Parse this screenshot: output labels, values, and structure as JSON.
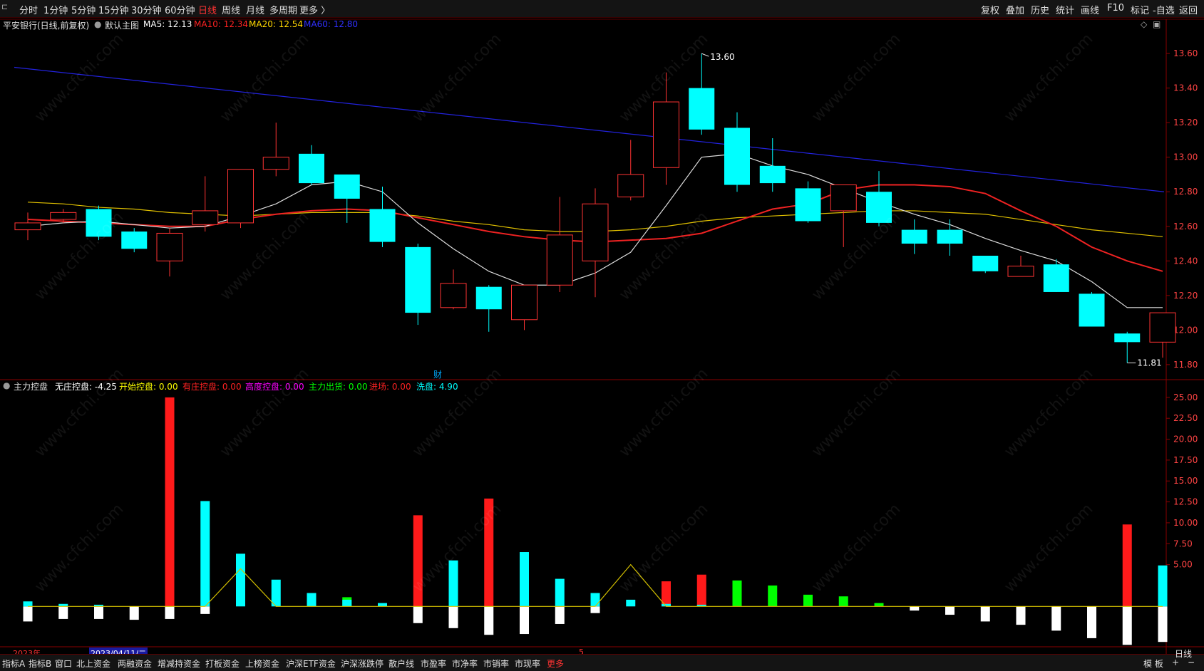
{
  "toolbar": {
    "back_icon": "back-arrow-icon",
    "periods": [
      "分时",
      "1分钟",
      "5分钟",
      "15分钟",
      "30分钟",
      "60分钟",
      "日线",
      "周线",
      "月线",
      "多周期",
      "更多 〉"
    ],
    "active_period": "日线",
    "right_buttons": [
      "复权",
      "叠加",
      "历史",
      "统计",
      "画线",
      "F10",
      "标记",
      "-自选",
      "返回"
    ]
  },
  "main_info": {
    "stock_title": "平安银行(日线,前复权)",
    "chart_name": "默认主图",
    "ma5": "MA5: 12.13",
    "ma10": "MA10: 12.34",
    "ma20": "MA20: 12.54",
    "ma60": "MA60: 12.80",
    "colors": {
      "ma5": "#ffffff",
      "ma10": "#ff2222",
      "ma20": "#ffd700",
      "ma60": "#3030ff",
      "up": "#ff3333",
      "down": "#00ffff"
    }
  },
  "indicator_info": {
    "name": "主力控盘",
    "items": [
      {
        "label": "无庄控盘: -4.25",
        "color": "#ffffff"
      },
      {
        "label": "开始控盘: 0.00",
        "color": "#ffff00"
      },
      {
        "label": "有庄控盘: 0.00",
        "color": "#ff2222"
      },
      {
        "label": "高度控盘: 0.00",
        "color": "#ff00ff"
      },
      {
        "label": "主力出货: 0.00",
        "color": "#00ff00"
      },
      {
        "label": "进场: 0.00",
        "color": "#ff2222"
      },
      {
        "label": "洗盘: 4.90",
        "color": "#00ffff"
      }
    ]
  },
  "chart_data": [
    {
      "type": "candlestick",
      "y_ticks": [
        "13.60",
        "13.40",
        "13.20",
        "13.00",
        "12.80",
        "12.60",
        "12.40",
        "12.20",
        "12.00",
        "11.80"
      ],
      "ylim": [
        11.75,
        13.72
      ],
      "high_label": "13.60",
      "low_label": "11.81",
      "event_marker": "财",
      "candles": [
        {
          "o": 12.58,
          "c": 12.62,
          "h": 12.68,
          "l": 12.52
        },
        {
          "o": 12.64,
          "c": 12.68,
          "h": 12.7,
          "l": 12.62
        },
        {
          "o": 12.7,
          "c": 12.54,
          "h": 12.72,
          "l": 12.52
        },
        {
          "o": 12.57,
          "c": 12.47,
          "h": 12.59,
          "l": 12.45
        },
        {
          "o": 12.4,
          "c": 12.56,
          "h": 12.59,
          "l": 12.31
        },
        {
          "o": 12.61,
          "c": 12.69,
          "h": 12.89,
          "l": 12.57
        },
        {
          "o": 12.62,
          "c": 12.93,
          "h": 12.93,
          "l": 12.59
        },
        {
          "o": 12.93,
          "c": 13.0,
          "h": 13.2,
          "l": 12.89
        },
        {
          "o": 13.02,
          "c": 12.85,
          "h": 13.07,
          "l": 12.84
        },
        {
          "o": 12.9,
          "c": 12.76,
          "h": 12.9,
          "l": 12.62
        },
        {
          "o": 12.7,
          "c": 12.51,
          "h": 12.83,
          "l": 12.48
        },
        {
          "o": 12.48,
          "c": 12.1,
          "h": 12.5,
          "l": 12.03
        },
        {
          "o": 12.13,
          "c": 12.27,
          "h": 12.35,
          "l": 12.12
        },
        {
          "o": 12.25,
          "c": 12.12,
          "h": 12.26,
          "l": 11.99
        },
        {
          "o": 12.06,
          "c": 12.26,
          "h": 12.26,
          "l": 12.0
        },
        {
          "o": 12.26,
          "c": 12.55,
          "h": 12.77,
          "l": 12.22
        },
        {
          "o": 12.4,
          "c": 12.73,
          "h": 12.82,
          "l": 12.19
        },
        {
          "o": 12.77,
          "c": 12.9,
          "h": 13.1,
          "l": 12.75
        },
        {
          "o": 12.94,
          "c": 13.32,
          "h": 13.49,
          "l": 12.84
        },
        {
          "o": 13.4,
          "c": 13.16,
          "h": 13.6,
          "l": 13.13
        },
        {
          "o": 13.17,
          "c": 12.84,
          "h": 13.26,
          "l": 12.8
        },
        {
          "o": 12.95,
          "c": 12.85,
          "h": 13.11,
          "l": 12.8
        },
        {
          "o": 12.82,
          "c": 12.63,
          "h": 12.86,
          "l": 12.62
        },
        {
          "o": 12.69,
          "c": 12.84,
          "h": 12.84,
          "l": 12.48
        },
        {
          "o": 12.8,
          "c": 12.62,
          "h": 12.92,
          "l": 12.6
        },
        {
          "o": 12.58,
          "c": 12.5,
          "h": 12.64,
          "l": 12.44
        },
        {
          "o": 12.58,
          "c": 12.5,
          "h": 12.64,
          "l": 12.43
        },
        {
          "o": 12.43,
          "c": 12.34,
          "h": 12.43,
          "l": 12.33
        },
        {
          "o": 12.31,
          "c": 12.37,
          "h": 12.43,
          "l": 12.31
        },
        {
          "o": 12.38,
          "c": 12.22,
          "h": 12.41,
          "l": 12.22
        },
        {
          "o": 12.21,
          "c": 12.02,
          "h": 12.22,
          "l": 12.02
        },
        {
          "o": 11.98,
          "c": 11.93,
          "h": 11.99,
          "l": 11.81
        },
        {
          "o": 11.93,
          "c": 12.1,
          "h": 12.1,
          "l": 11.84
        }
      ],
      "ma5": [
        12.6,
        12.62,
        12.63,
        12.61,
        12.59,
        12.6,
        12.66,
        12.73,
        12.84,
        12.86,
        12.8,
        12.62,
        12.47,
        12.34,
        12.26,
        12.26,
        12.33,
        12.45,
        12.72,
        13.0,
        13.02,
        12.95,
        12.9,
        12.82,
        12.74,
        12.67,
        12.61,
        12.53,
        12.46,
        12.4,
        12.28,
        12.13,
        12.13
      ],
      "ma10": [
        12.64,
        12.63,
        12.62,
        12.61,
        12.6,
        12.6,
        12.64,
        12.67,
        12.69,
        12.7,
        12.69,
        12.65,
        12.61,
        12.57,
        12.54,
        12.52,
        12.51,
        12.52,
        12.53,
        12.56,
        12.63,
        12.7,
        12.73,
        12.81,
        12.84,
        12.84,
        12.83,
        12.79,
        12.69,
        12.6,
        12.48,
        12.4,
        12.34
      ],
      "ma20": [
        12.74,
        12.73,
        12.71,
        12.7,
        12.68,
        12.67,
        12.66,
        12.67,
        12.68,
        12.68,
        12.68,
        12.66,
        12.63,
        12.61,
        12.58,
        12.57,
        12.57,
        12.58,
        12.6,
        12.63,
        12.65,
        12.66,
        12.67,
        12.68,
        12.69,
        12.69,
        12.68,
        12.67,
        12.64,
        12.61,
        12.58,
        12.56,
        12.54
      ],
      "ma60_start": 13.52,
      "ma60_end": 12.8
    },
    {
      "type": "bar",
      "y_ticks": [
        "25.00",
        "22.50",
        "20.00",
        "17.50",
        "15.00",
        "12.50",
        "10.00",
        "7.50",
        "5.00"
      ],
      "ylim": [
        -5.0,
        25.5
      ],
      "bars": [
        {
          "pos": 0.6,
          "neg": -1.8,
          "pos_color": "#00ffff"
        },
        {
          "pos": 0.3,
          "neg": -1.5,
          "pos_color": "#00ffff"
        },
        {
          "pos": 0.2,
          "neg": -1.5,
          "pos_color": "#00ffff"
        },
        {
          "pos": 0.0,
          "neg": -1.6,
          "pos_color": "#00ffff"
        },
        {
          "pos": 25.0,
          "neg": -1.5,
          "pos_color": "#ff1a1a"
        },
        {
          "pos": 12.6,
          "neg": -0.9,
          "pos_color": "#00ffff"
        },
        {
          "pos": 6.3,
          "neg": 0,
          "pos_color": "#00ffff"
        },
        {
          "pos": 3.2,
          "neg": 0,
          "pos_color": "#00ffff"
        },
        {
          "pos": 1.6,
          "neg": 0,
          "pos_color": "#00ffff"
        },
        {
          "pos": 1.1,
          "neg": 0,
          "pos_color": "#00ff00",
          "pos2": 0.8,
          "pos2_color": "#00ffff"
        },
        {
          "pos": 0.4,
          "neg": 0,
          "pos_color": "#00ffff"
        },
        {
          "pos": 10.9,
          "neg": -2.0,
          "pos_color": "#ff1a1a"
        },
        {
          "pos": 5.5,
          "neg": -2.6,
          "pos_color": "#00ffff"
        },
        {
          "pos": 12.9,
          "neg": -3.4,
          "pos_color": "#ff1a1a"
        },
        {
          "pos": 6.5,
          "neg": -3.3,
          "pos_color": "#00ffff"
        },
        {
          "pos": 3.3,
          "neg": -2.1,
          "pos_color": "#00ffff"
        },
        {
          "pos": 1.6,
          "neg": -0.8,
          "pos_color": "#00ffff"
        },
        {
          "pos": 0.8,
          "neg": 0,
          "pos_color": "#00ffff"
        },
        {
          "pos": 3.0,
          "neg": 0,
          "pos_color": "#ff1a1a",
          "base": 0.3,
          "base_color": "#00ffff"
        },
        {
          "pos": 3.8,
          "neg": 0,
          "pos_color": "#ff1a1a",
          "base": 0.2,
          "base_color": "#00ffff"
        },
        {
          "pos": 3.1,
          "neg": 0,
          "pos_color": "#00ff00"
        },
        {
          "pos": 2.5,
          "neg": 0,
          "pos_color": "#00ff00"
        },
        {
          "pos": 1.4,
          "neg": 0,
          "pos_color": "#00ff00"
        },
        {
          "pos": 1.2,
          "neg": 0,
          "pos_color": "#00ff00"
        },
        {
          "pos": 0.4,
          "neg": 0,
          "pos_color": "#00ff00"
        },
        {
          "pos": 0.0,
          "neg": -0.5,
          "pos_color": "#00ffff"
        },
        {
          "pos": 0.0,
          "neg": -1.0,
          "pos_color": "#00ffff"
        },
        {
          "pos": 0.0,
          "neg": -1.8,
          "pos_color": "#00ffff"
        },
        {
          "pos": 0.0,
          "neg": -2.2,
          "pos_color": "#00ffff"
        },
        {
          "pos": 0.0,
          "neg": -2.9,
          "pos_color": "#00ffff"
        },
        {
          "pos": 0.0,
          "neg": -3.8,
          "pos_color": "#00ffff"
        },
        {
          "pos": 9.8,
          "neg": -4.6,
          "pos_color": "#ff1a1a"
        },
        {
          "pos": 4.9,
          "neg": -4.25,
          "pos_color": "#00ffff"
        }
      ],
      "yellow_line": [
        0,
        0,
        0,
        0,
        0,
        0,
        4.5,
        0,
        0,
        0,
        0,
        0,
        0,
        0,
        0,
        0,
        0,
        5.0,
        0,
        0,
        0,
        0,
        0,
        0,
        0,
        0,
        0,
        0,
        0,
        0,
        0,
        0,
        0
      ]
    }
  ],
  "date_bar": {
    "year": "2023年",
    "cursor_date": "2023/04/11/二",
    "mark": "5"
  },
  "bottom_tabs": [
    "指标A",
    "指标B",
    "窗口",
    "北上资金",
    "两融资金",
    "增减持资金",
    "打板资金",
    "上榜资金",
    "沪深ETF资金",
    "沪深涨跌停",
    "散户线",
    "市盈率",
    "市净率",
    "市销率",
    "市现率",
    "更多"
  ],
  "bottom_right": {
    "template": "模 板",
    "plus": "+",
    "minus": "−",
    "period": "日线"
  },
  "watermark": "www.cfchi.com"
}
